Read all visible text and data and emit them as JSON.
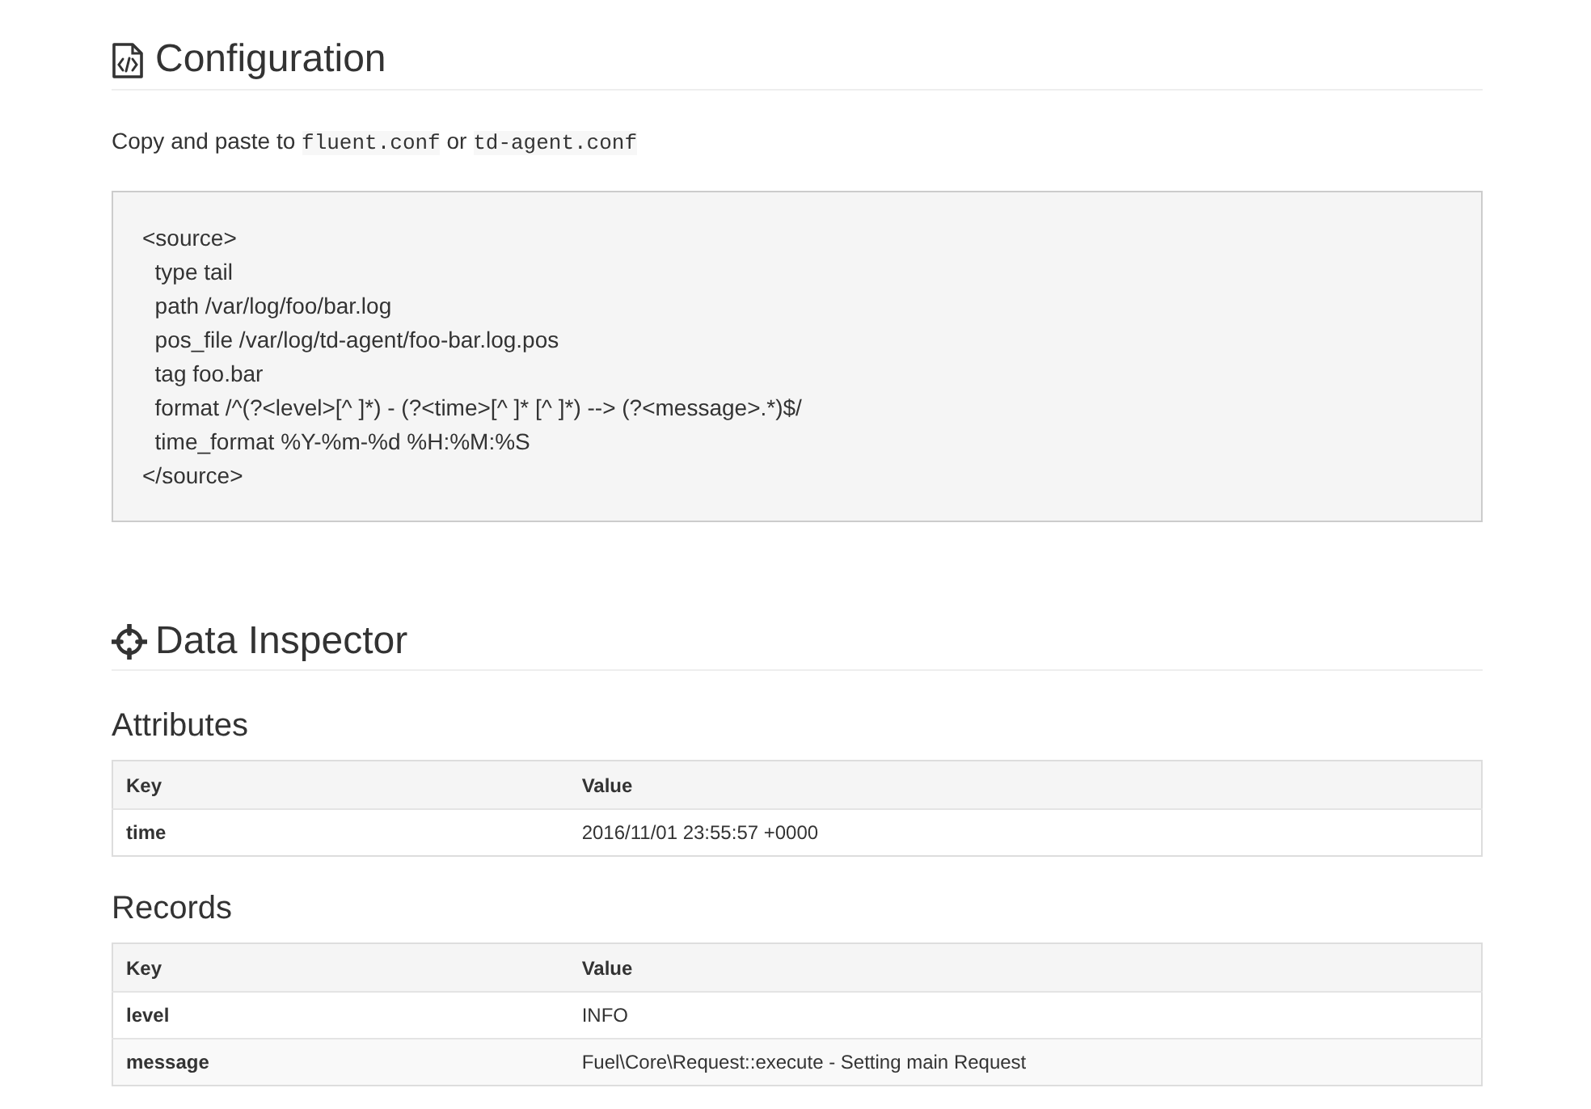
{
  "configuration": {
    "title": "Configuration",
    "intro": [
      {
        "kind": "text",
        "text": "Copy and paste to"
      },
      {
        "kind": "code",
        "text": "fluent.conf"
      },
      {
        "kind": "text",
        "text": "or"
      },
      {
        "kind": "code",
        "text": "td-agent.conf"
      }
    ],
    "code_lines": [
      "<source>",
      "  type tail",
      "  path /var/log/foo/bar.log",
      "  pos_file /var/log/td-agent/foo-bar.log.pos",
      "  tag foo.bar",
      "  format /^(?<level>[^ ]*) - (?<time>[^ ]* [^ ]*) --> (?<message>.*)$/",
      "  time_format %Y-%m-%d %H:%M:%S",
      "</source>"
    ]
  },
  "data_inspector": {
    "title": "Data Inspector",
    "attributes": {
      "title": "Attributes",
      "columns": [
        "Key",
        "Value"
      ],
      "rows": [
        {
          "key": "time",
          "value": "2016/11/01 23:55:57 +0000"
        }
      ]
    },
    "records": {
      "title": "Records",
      "columns": [
        "Key",
        "Value"
      ],
      "rows": [
        {
          "key": "level",
          "value": "INFO"
        },
        {
          "key": "message",
          "value": "Fuel\\Core\\Request::execute - Setting main Request"
        }
      ]
    }
  }
}
